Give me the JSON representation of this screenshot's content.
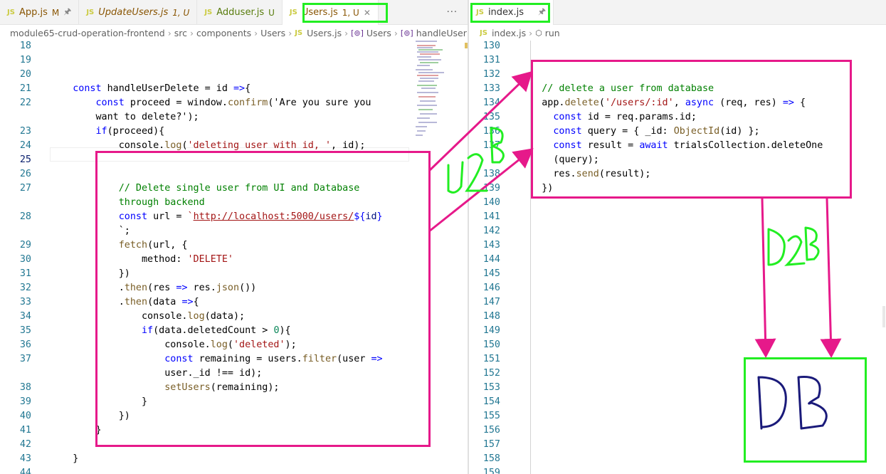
{
  "left_tabs": [
    {
      "icon": "JS",
      "name": "App.js",
      "status": "M",
      "extra": "pin"
    },
    {
      "icon": "JS",
      "name": "UpdateUsers.js",
      "status": "1, U",
      "extra": "close"
    },
    {
      "icon": "JS",
      "name": "Adduser.js",
      "status": "U",
      "extra": ""
    },
    {
      "icon": "JS",
      "name": "Users.js",
      "status": "1, U",
      "extra": "close"
    }
  ],
  "left_more": "···",
  "right_tabs": [
    {
      "icon": "JS",
      "name": "index.js",
      "extra": "pin"
    }
  ],
  "left_breadcrumb": {
    "parts": [
      "module65-crud-operation-frontend",
      "src",
      "components",
      "Users"
    ],
    "file_icon": "JS",
    "file": "Users.js",
    "symbols": [
      "Users",
      "handleUserDelete"
    ]
  },
  "right_breadcrumb": {
    "file_icon": "JS",
    "file": "index.js",
    "symbols": [
      "run"
    ]
  },
  "left_code": [
    {
      "n": "18",
      "t": ""
    },
    {
      "n": "19",
      "t": ""
    },
    {
      "n": "20",
      "t": ""
    },
    {
      "n": "21",
      "t": "    const handleUserDelete = id =>{"
    },
    {
      "n": "22",
      "t": "        const proceed = window.confirm('Are you sure you"
    },
    {
      "n": "",
      "t": "        want to delete?');"
    },
    {
      "n": "23",
      "t": "        if(proceed){"
    },
    {
      "n": "24",
      "t": "            console.log('deleting user with id, ', id);"
    },
    {
      "n": "25",
      "t": ""
    },
    {
      "n": "26",
      "t": ""
    },
    {
      "n": "27",
      "t": "            // Delete single user from UI and Database"
    },
    {
      "n": "",
      "t": "            through backend"
    },
    {
      "n": "28",
      "t": "            const url = `http://localhost:5000/users/${id}"
    },
    {
      "n": "",
      "t": "            `;"
    },
    {
      "n": "29",
      "t": "            fetch(url, {"
    },
    {
      "n": "30",
      "t": "                method: 'DELETE'"
    },
    {
      "n": "31",
      "t": "            })"
    },
    {
      "n": "32",
      "t": "            .then(res => res.json())"
    },
    {
      "n": "33",
      "t": "            .then(data =>{"
    },
    {
      "n": "34",
      "t": "                console.log(data);"
    },
    {
      "n": "35",
      "t": "                if(data.deletedCount > 0){"
    },
    {
      "n": "36",
      "t": "                    console.log('deleted');"
    },
    {
      "n": "37",
      "t": "                    const remaining = users.filter(user =>"
    },
    {
      "n": "",
      "t": "                    user._id !== id);"
    },
    {
      "n": "38",
      "t": "                    setUsers(remaining);"
    },
    {
      "n": "39",
      "t": "                }"
    },
    {
      "n": "40",
      "t": "            })"
    },
    {
      "n": "41",
      "t": "        }"
    },
    {
      "n": "42",
      "t": ""
    },
    {
      "n": "43",
      "t": "    }"
    },
    {
      "n": "44",
      "t": ""
    }
  ],
  "right_code": [
    {
      "n": "130",
      "t": ""
    },
    {
      "n": "131",
      "t": ""
    },
    {
      "n": "132",
      "t": ""
    },
    {
      "n": "133",
      "t": "    // delete a user from database"
    },
    {
      "n": "134",
      "t": "    app.delete('/users/:id', async (req, res) => {"
    },
    {
      "n": "135",
      "t": "      const id = req.params.id;"
    },
    {
      "n": "136",
      "t": "      const query = { _id: ObjectId(id) };"
    },
    {
      "n": "137",
      "t": "      const result = await trialsCollection.deleteOne"
    },
    {
      "n": "",
      "t": "      (query);"
    },
    {
      "n": "138",
      "t": "      res.send(result);"
    },
    {
      "n": "139",
      "t": "    })"
    },
    {
      "n": "140",
      "t": ""
    },
    {
      "n": "141",
      "t": ""
    },
    {
      "n": "142",
      "t": ""
    },
    {
      "n": "143",
      "t": ""
    },
    {
      "n": "144",
      "t": ""
    },
    {
      "n": "145",
      "t": ""
    },
    {
      "n": "146",
      "t": ""
    },
    {
      "n": "147",
      "t": ""
    },
    {
      "n": "148",
      "t": ""
    },
    {
      "n": "149",
      "t": ""
    },
    {
      "n": "150",
      "t": ""
    },
    {
      "n": "151",
      "t": ""
    },
    {
      "n": "152",
      "t": ""
    },
    {
      "n": "153",
      "t": ""
    },
    {
      "n": "154",
      "t": ""
    },
    {
      "n": "155",
      "t": ""
    },
    {
      "n": "156",
      "t": ""
    },
    {
      "n": "157",
      "t": ""
    },
    {
      "n": "158",
      "t": ""
    },
    {
      "n": "159",
      "t": ""
    }
  ],
  "annotations": {
    "u2b": "U2B",
    "d2b": "D2B",
    "db": "DB",
    "pink": "#e6198a",
    "green": "#22ee22",
    "navy": "#1a1a7a"
  },
  "colors": {
    "keyword": "#0000ff",
    "function": "#795e26",
    "string": "#a31515",
    "comment": "#008000",
    "line_number": "#237893"
  }
}
